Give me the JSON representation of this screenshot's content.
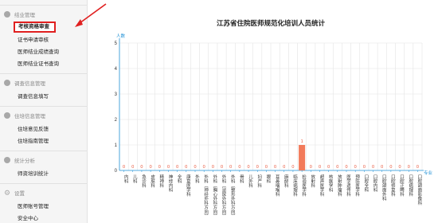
{
  "sidebar": {
    "groups": [
      {
        "title": "结业管理",
        "items": [
          "考核资格审查",
          "证书申请审核",
          "医师结业成绩查询",
          "医师结业证书查询"
        ]
      },
      {
        "title": "调查信息管理",
        "items": [
          "调查信息填写"
        ]
      },
      {
        "title": "住培信息管理",
        "items": [
          "住培意见反馈",
          "住培指南管理"
        ]
      },
      {
        "title": "统计分析",
        "items": [
          "师资培训统计"
        ]
      },
      {
        "title": "设置",
        "items": [
          "医师账号管理",
          "安全中心"
        ]
      }
    ]
  },
  "colors": {
    "accent": "#1e90d6",
    "bar": "#f27a5a",
    "highlight": "#e02020"
  },
  "chart_data": {
    "type": "bar",
    "title": "江苏省住院医师规范化培训人员统计",
    "ylabel": "人数",
    "xlabel": "专业",
    "ylim": [
      0,
      5
    ],
    "yticks": [
      0,
      1,
      2,
      3,
      4,
      5
    ],
    "grid": true,
    "categories": [
      "内科",
      "儿科",
      "急诊科",
      "皮肤科",
      "精神科",
      "神经内科",
      "全科",
      "康复医学科",
      "外科",
      "外科（神经外科方向）",
      "外科（胸心外科方向）",
      "外科（泌尿外科方向）",
      "外科（整形外科方向）",
      "骨科",
      "儿外科",
      "妇产科",
      "眼科",
      "耳鼻咽喉科",
      "麻醉科",
      "临床病理科",
      "检验医学科",
      "放射科",
      "超声医学科",
      "核医学科",
      "放射肿瘤科",
      "医学遗传科",
      "预防医学科",
      "口腔全科",
      "口腔内科",
      "口腔颌面外科",
      "口腔修复科",
      "口腔正畸科",
      "口腔病理科",
      "口腔颌面影像科"
    ],
    "values": [
      0,
      0,
      0,
      0,
      0,
      0,
      0,
      0,
      0,
      0,
      0,
      0,
      0,
      0,
      0,
      0,
      0,
      0,
      0,
      0,
      1,
      0,
      0,
      0,
      0,
      0,
      0,
      0,
      0,
      0,
      0,
      0,
      0,
      0
    ]
  }
}
